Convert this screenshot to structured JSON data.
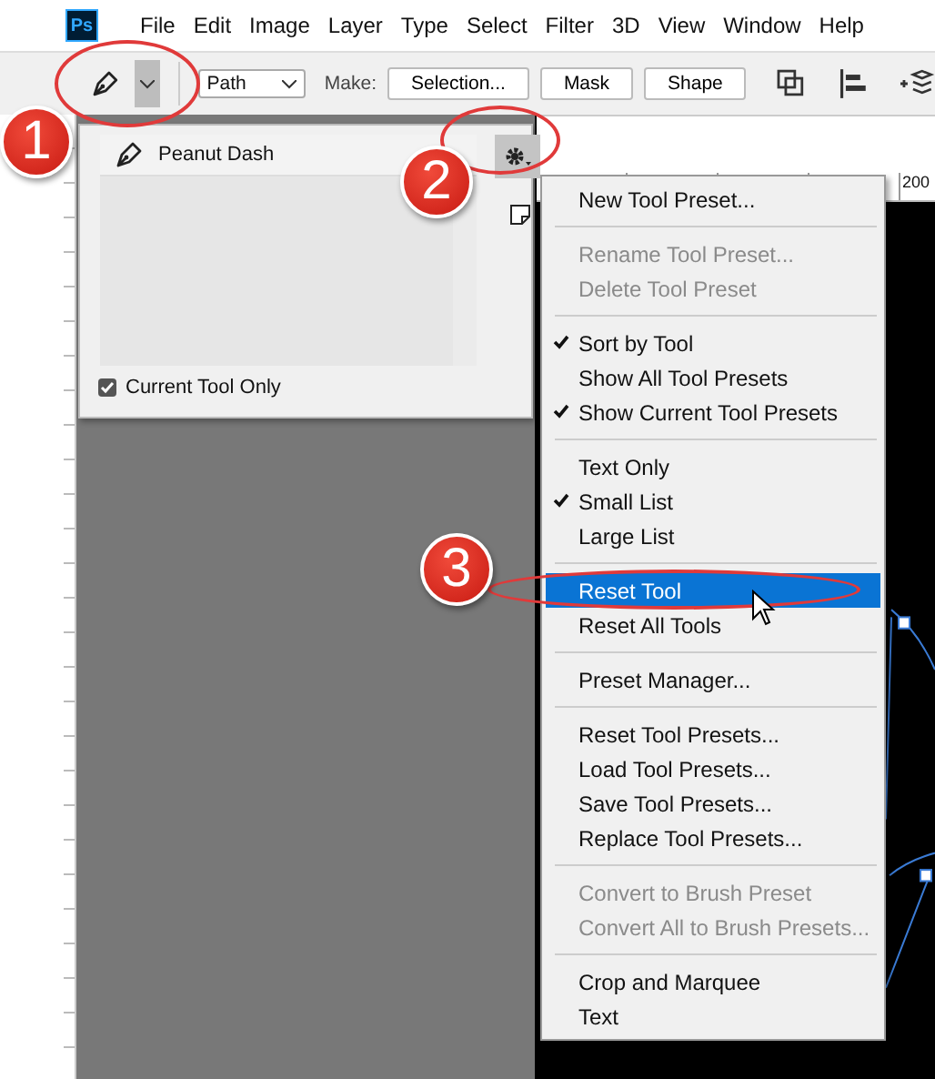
{
  "app_logo": "Ps",
  "menu_bar": [
    "File",
    "Edit",
    "Image",
    "Layer",
    "Type",
    "Select",
    "Filter",
    "3D",
    "View",
    "Window",
    "Help"
  ],
  "options_bar": {
    "mode": "Path",
    "make_label": "Make:",
    "buttons": [
      "Selection...",
      "Mask",
      "Shape"
    ]
  },
  "ruler": {
    "label": "200"
  },
  "preset_panel": {
    "presets": [
      {
        "name": "Peanut Dash"
      }
    ],
    "current_tool_only": {
      "label": "Current Tool Only",
      "checked": true
    }
  },
  "panel_menu": {
    "sections": [
      [
        {
          "label": "New Tool Preset...",
          "checked": false,
          "disabled": false,
          "selected": false
        }
      ],
      [
        {
          "label": "Rename Tool Preset...",
          "checked": false,
          "disabled": true,
          "selected": false
        },
        {
          "label": "Delete Tool Preset",
          "checked": false,
          "disabled": true,
          "selected": false
        }
      ],
      [
        {
          "label": "Sort by Tool",
          "checked": true,
          "disabled": false,
          "selected": false
        },
        {
          "label": "Show All Tool Presets",
          "checked": false,
          "disabled": false,
          "selected": false
        },
        {
          "label": "Show Current Tool Presets",
          "checked": true,
          "disabled": false,
          "selected": false
        }
      ],
      [
        {
          "label": "Text Only",
          "checked": false,
          "disabled": false,
          "selected": false
        },
        {
          "label": "Small List",
          "checked": true,
          "disabled": false,
          "selected": false
        },
        {
          "label": "Large List",
          "checked": false,
          "disabled": false,
          "selected": false
        }
      ],
      [
        {
          "label": "Reset Tool",
          "checked": false,
          "disabled": false,
          "selected": true
        },
        {
          "label": "Reset All Tools",
          "checked": false,
          "disabled": false,
          "selected": false
        }
      ],
      [
        {
          "label": "Preset Manager...",
          "checked": false,
          "disabled": false,
          "selected": false
        }
      ],
      [
        {
          "label": "Reset Tool Presets...",
          "checked": false,
          "disabled": false,
          "selected": false
        },
        {
          "label": "Load Tool Presets...",
          "checked": false,
          "disabled": false,
          "selected": false
        },
        {
          "label": "Save Tool Presets...",
          "checked": false,
          "disabled": false,
          "selected": false
        },
        {
          "label": "Replace Tool Presets...",
          "checked": false,
          "disabled": false,
          "selected": false
        }
      ],
      [
        {
          "label": "Convert to Brush Preset",
          "checked": false,
          "disabled": true,
          "selected": false
        },
        {
          "label": "Convert All to Brush Presets...",
          "checked": false,
          "disabled": true,
          "selected": false
        }
      ],
      [
        {
          "label": "Crop and Marquee",
          "checked": false,
          "disabled": false,
          "selected": false
        },
        {
          "label": "Text",
          "checked": false,
          "disabled": false,
          "selected": false
        }
      ]
    ]
  },
  "annotations": [
    {
      "label": "1"
    },
    {
      "label": "2"
    },
    {
      "label": "3"
    }
  ]
}
